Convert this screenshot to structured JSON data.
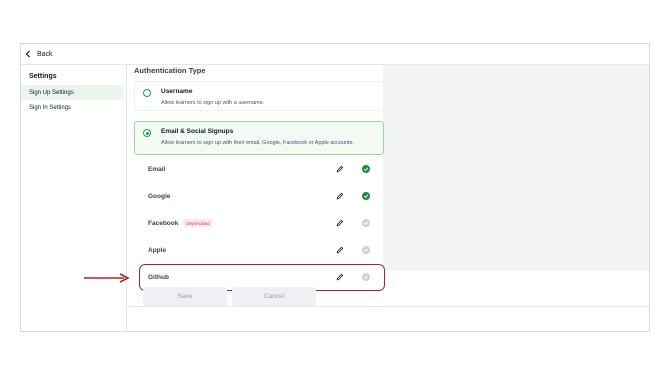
{
  "topbar": {
    "back_label": "Back"
  },
  "sidebar": {
    "title": "Settings",
    "items": [
      {
        "label": "Sign Up Settings",
        "active": true
      },
      {
        "label": "Sign In Settings",
        "active": false
      }
    ]
  },
  "main": {
    "section_title": "Authentication Type",
    "options": [
      {
        "title": "Username",
        "description": "Allow learners to sign up with a username.",
        "selected": false
      },
      {
        "title": "Email & Social Signups",
        "description": "Allow learners to sign up with their email, Google, Facebook or Apple accounts.",
        "selected": true
      }
    ],
    "providers": [
      {
        "name": "Email",
        "enabled": true
      },
      {
        "name": "Google",
        "enabled": true
      },
      {
        "name": "Facebook",
        "badge": "Deprecated",
        "enabled": false
      },
      {
        "name": "Apple",
        "enabled": false
      },
      {
        "name": "Github",
        "enabled": false
      }
    ],
    "buttons": {
      "save": "Save",
      "cancel": "Cancel"
    }
  },
  "colors": {
    "accent_green": "#22a04b",
    "check_enabled": "#1f8a3e",
    "check_disabled": "#c9d1dc",
    "highlight_red": "#a3262e"
  }
}
